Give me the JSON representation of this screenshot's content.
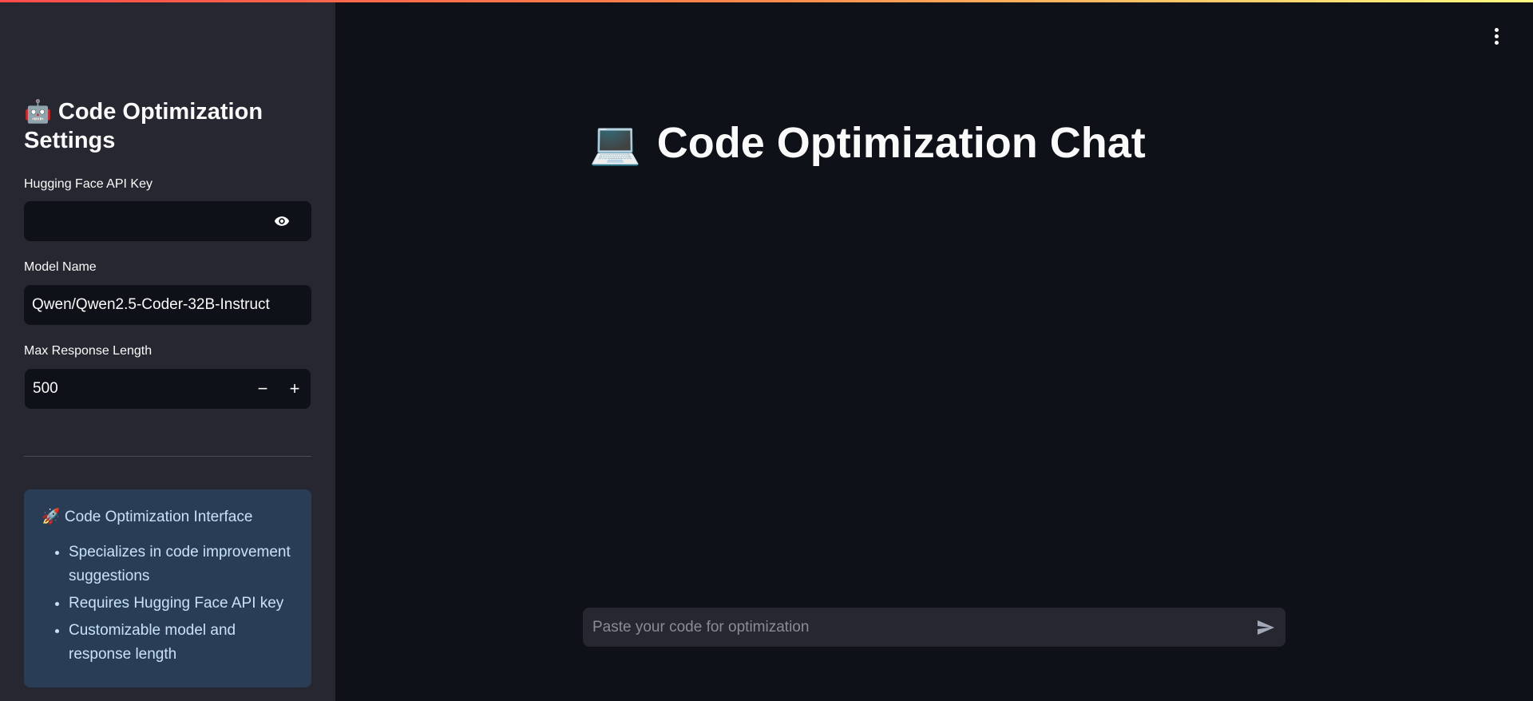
{
  "sidebar": {
    "title_emoji": "🤖",
    "title": "Code Optimization Settings",
    "api_key": {
      "label": "Hugging Face API Key",
      "value": ""
    },
    "model": {
      "label": "Model Name",
      "value": "Qwen/Qwen2.5-Coder-32B-Instruct"
    },
    "max_length": {
      "label": "Max Response Length",
      "value": "500",
      "minus": "−",
      "plus": "+"
    },
    "info": {
      "title": "🚀 Code Optimization Interface",
      "items": [
        "Specializes in code improvement suggestions",
        "Requires Hugging Face API key",
        "Customizable model and response length"
      ]
    }
  },
  "main": {
    "title_emoji": "💻",
    "title": "Code Optimization Chat",
    "chat_input": {
      "placeholder": "Paste your code for optimization"
    }
  },
  "colors": {
    "background": "#0e1117",
    "sidebar": "#262730",
    "info_bg": "#2a3d56",
    "info_text": "#c8e1fb",
    "accent_gradient_start": "#ff4b4b",
    "accent_gradient_end": "#fffd80"
  },
  "icons": [
    "robot-emoji",
    "eye-icon",
    "minus-icon",
    "plus-icon",
    "rocket-emoji",
    "laptop-emoji",
    "kebab-menu-icon",
    "send-icon"
  ]
}
